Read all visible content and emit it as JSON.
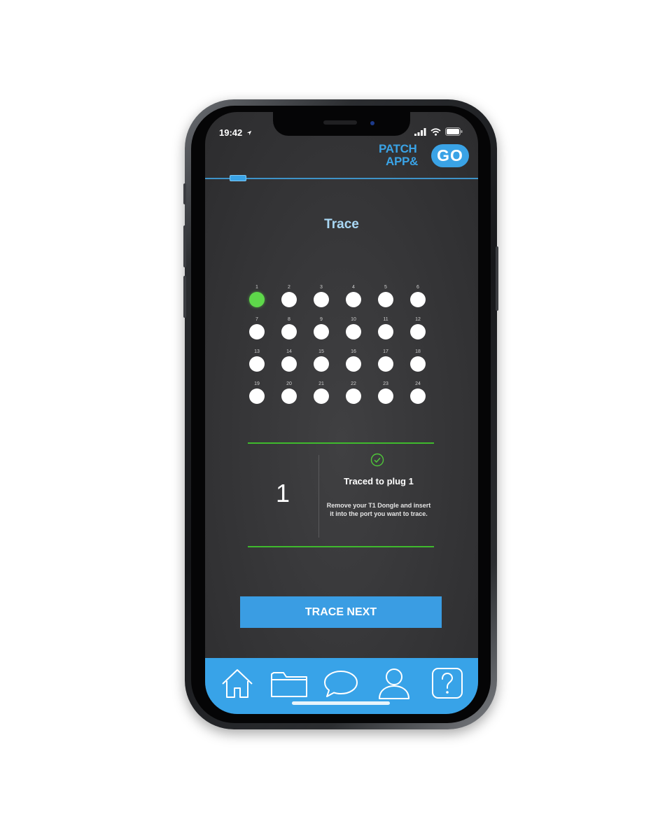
{
  "status_bar": {
    "time": "19:42"
  },
  "logo": {
    "line1": "PATCH",
    "line2": "APP&",
    "badge": "GO"
  },
  "progress": {
    "step_fraction": 0.05
  },
  "screen": {
    "title": "Trace"
  },
  "ports": [
    {
      "num": "1",
      "active": true
    },
    {
      "num": "2",
      "active": false
    },
    {
      "num": "3",
      "active": false
    },
    {
      "num": "4",
      "active": false
    },
    {
      "num": "5",
      "active": false
    },
    {
      "num": "6",
      "active": false
    },
    {
      "num": "7",
      "active": false
    },
    {
      "num": "8",
      "active": false
    },
    {
      "num": "9",
      "active": false
    },
    {
      "num": "10",
      "active": false
    },
    {
      "num": "11",
      "active": false
    },
    {
      "num": "12",
      "active": false
    },
    {
      "num": "13",
      "active": false
    },
    {
      "num": "14",
      "active": false
    },
    {
      "num": "15",
      "active": false
    },
    {
      "num": "16",
      "active": false
    },
    {
      "num": "17",
      "active": false
    },
    {
      "num": "18",
      "active": false
    },
    {
      "num": "19",
      "active": false
    },
    {
      "num": "20",
      "active": false
    },
    {
      "num": "21",
      "active": false
    },
    {
      "num": "22",
      "active": false
    },
    {
      "num": "23",
      "active": false
    },
    {
      "num": "24",
      "active": false
    }
  ],
  "result": {
    "plug_number": "1",
    "status": "Traced to plug 1",
    "instruction": "Remove your T1 Dongle and insert it into the port you want to trace."
  },
  "actions": {
    "trace_next": "TRACE NEXT"
  },
  "tabbar": {
    "icons": [
      "home-icon",
      "folder-icon",
      "chat-icon",
      "user-icon",
      "help-icon"
    ]
  },
  "colors": {
    "accent": "#3aa3e6",
    "active_port": "#5ed84a",
    "divider_green": "#3fba2d",
    "background": "#353537"
  }
}
